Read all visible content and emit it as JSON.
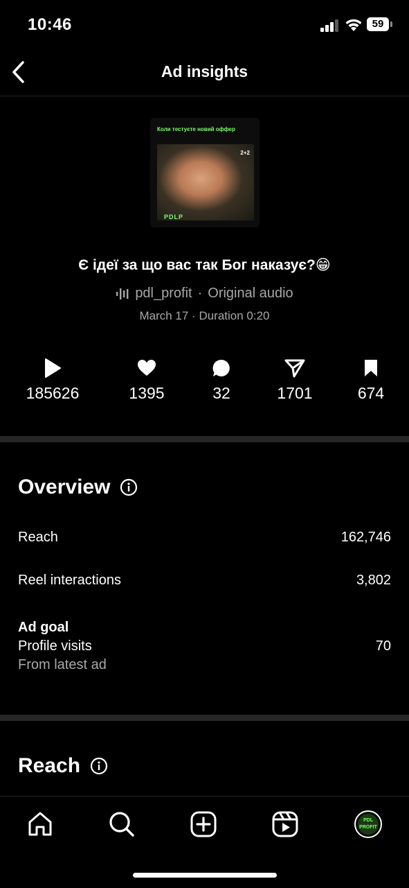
{
  "status_bar": {
    "time": "10:46",
    "battery": "59"
  },
  "header": {
    "title": "Ad insights"
  },
  "thumbnail": {
    "caption": "Коли тестуєте новий оффер",
    "badge": "2+2",
    "logo": "PDLP"
  },
  "post": {
    "caption": "Є ідеї за що вас так Бог наказує?😁",
    "audio_user": "pdl_profit",
    "audio_sep": "·",
    "audio_type": "Original audio",
    "meta": "March 17 · Duration 0:20"
  },
  "stats": [
    {
      "icon": "play-icon",
      "value": "185626"
    },
    {
      "icon": "heart-icon",
      "value": "1395"
    },
    {
      "icon": "comment-icon",
      "value": "32"
    },
    {
      "icon": "share-icon",
      "value": "1701"
    },
    {
      "icon": "bookmark-icon",
      "value": "674"
    }
  ],
  "overview": {
    "title": "Overview",
    "reach_label": "Reach",
    "reach_value": "162,746",
    "interactions_label": "Reel interactions",
    "interactions_value": "3,802",
    "goal_label": "Ad goal",
    "goal_name": "Profile visits",
    "goal_source": "From latest ad",
    "goal_value": "70"
  },
  "reach_section": {
    "title": "Reach"
  },
  "avatar_text": "PDL PROFIT",
  "colors": {
    "background": "#000000",
    "muted": "#a8a8a8",
    "divider": "#262626",
    "brand": "#7dff6b"
  }
}
